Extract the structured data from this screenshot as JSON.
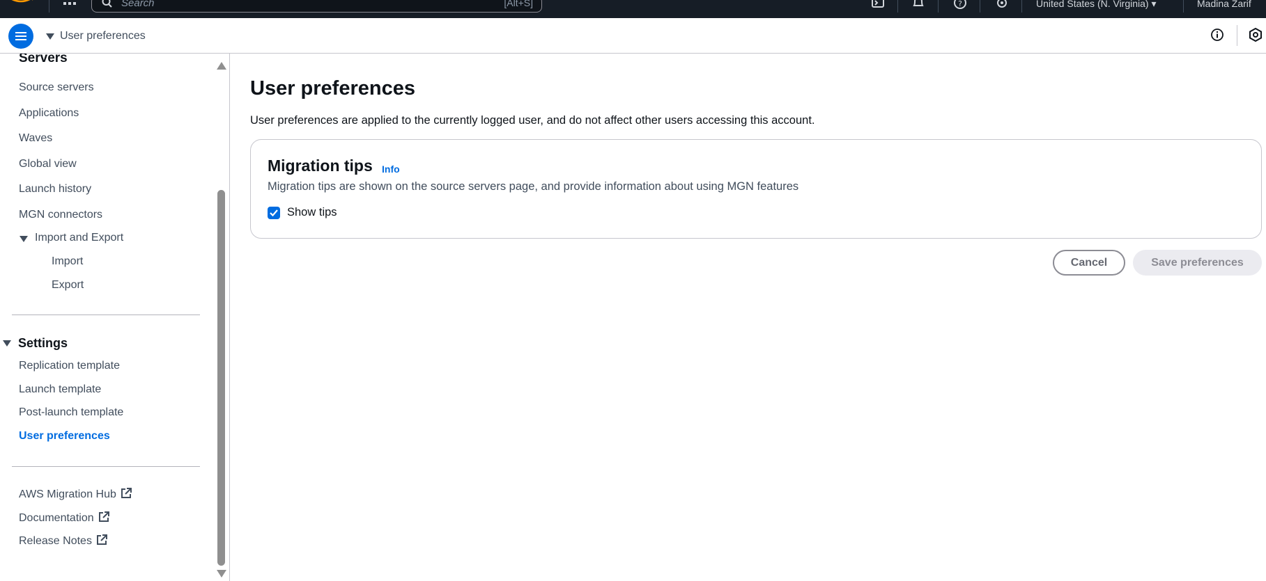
{
  "topnav": {
    "search_placeholder": "Search",
    "search_shortcut": "[Alt+S]",
    "region": "United States (N. Virginia)",
    "user": "Madina Zarif"
  },
  "subheader": {
    "breadcrumb": "User preferences"
  },
  "sidebar": {
    "servers_heading": "Servers",
    "servers_items": [
      "Source servers",
      "Applications",
      "Waves",
      "Global view",
      "Launch history",
      "MGN connectors"
    ],
    "import_export": {
      "label": "Import and Export",
      "children": [
        "Import",
        "Export"
      ]
    },
    "settings_heading": "Settings",
    "settings_items": [
      "Replication template",
      "Launch template",
      "Post-launch template",
      "User preferences"
    ],
    "active_item": "User preferences",
    "external_links": [
      "AWS Migration Hub",
      "Documentation",
      "Release Notes"
    ]
  },
  "main": {
    "title": "User preferences",
    "description": "User preferences are applied to the currently logged user, and do not affect other users accessing this account.",
    "container": {
      "title": "Migration tips",
      "info_link": "Info",
      "description": "Migration tips are shown on the source servers page, and provide information about using MGN features",
      "checkbox_label": "Show tips",
      "checkbox_checked": true
    },
    "cancel_label": "Cancel",
    "save_label": "Save preferences"
  },
  "colors": {
    "topnav_bg": "#161d26",
    "accent_blue": "#006ce0",
    "text_primary": "#0f141a",
    "text_secondary": "#414d5c",
    "border": "#c6c6cd"
  }
}
